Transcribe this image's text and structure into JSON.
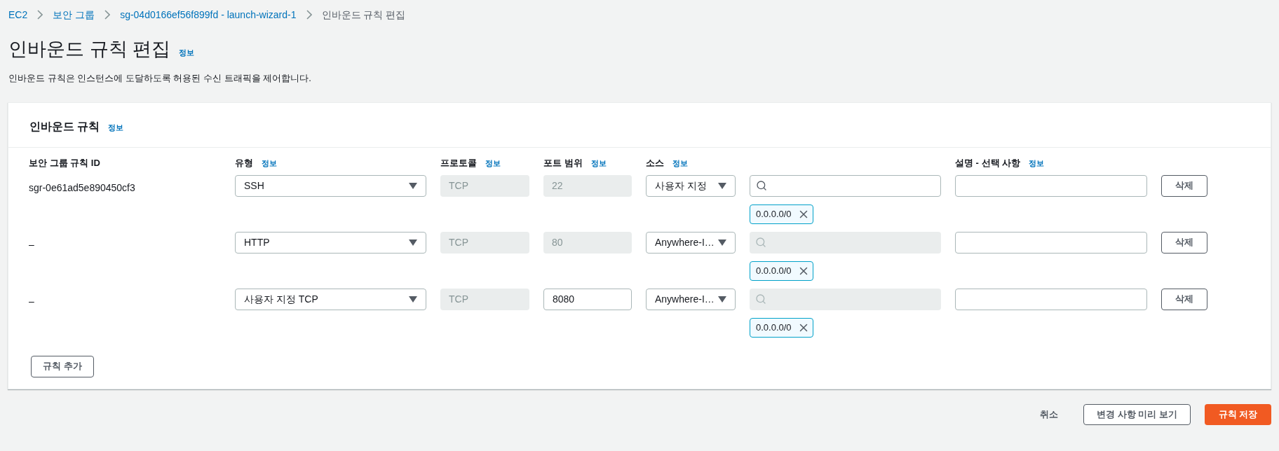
{
  "breadcrumb": [
    {
      "label": "EC2",
      "kind": "link"
    },
    {
      "label": "보안 그룹",
      "kind": "link"
    },
    {
      "label": "sg-04d0166ef56f899fd - launch-wizard-1",
      "kind": "link"
    },
    {
      "label": "인바운드 규칙 편집",
      "kind": "current"
    }
  ],
  "page": {
    "title": "인바운드 규칙 편집",
    "info": "정보",
    "description": "인바운드 규칙은 인스턴스에 도달하도록 허용된 수신 트래픽을 제어합니다."
  },
  "panel": {
    "title": "인바운드 규칙",
    "info": "정보",
    "columns": [
      {
        "label": "보안 그룹 규칙 ID"
      },
      {
        "label": "유형",
        "info": "정보"
      },
      {
        "label": "프로토콜",
        "info": "정보"
      },
      {
        "label": "포트 범위",
        "info": "정보"
      },
      {
        "label": "소스",
        "info": "정보"
      },
      {
        "label": "설명 - 선택 사항",
        "info": "정보"
      }
    ],
    "rows": [
      {
        "rule_id": "sgr-0e61ad5e890450cf3",
        "type": "SSH",
        "protocol": "TCP",
        "port": "22",
        "port_disabled": true,
        "source": "사용자 지정",
        "search_disabled": false,
        "cidr": "0.0.0.0/0",
        "delete": "삭제"
      },
      {
        "rule_id": "–",
        "type": "HTTP",
        "protocol": "TCP",
        "port": "80",
        "port_disabled": true,
        "source": "Anywhere-I…",
        "search_disabled": true,
        "cidr": "0.0.0.0/0",
        "delete": "삭제"
      },
      {
        "rule_id": "–",
        "type": "사용자 지정 TCP",
        "protocol": "TCP",
        "port": "8080",
        "port_disabled": false,
        "source": "Anywhere-I…",
        "search_disabled": true,
        "cidr": "0.0.0.0/0",
        "delete": "삭제"
      }
    ],
    "add_button": "규칙 추가"
  },
  "footer": {
    "cancel": "취소",
    "preview": "변경 사항 미리 보기",
    "save": "규칙 저장"
  }
}
